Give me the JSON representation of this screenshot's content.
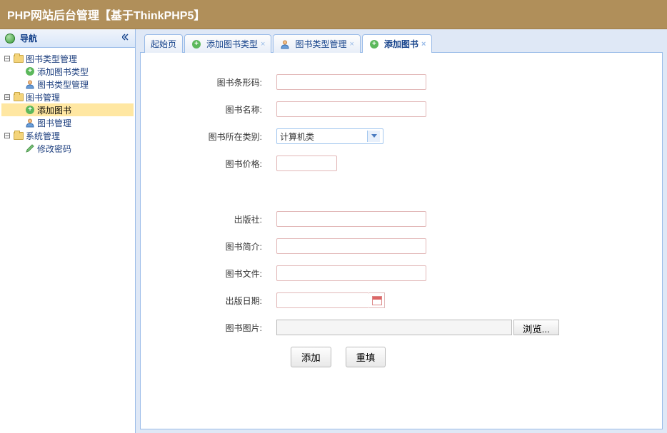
{
  "header": {
    "title": "PHP网站后台管理【基于ThinkPHP5】"
  },
  "sidebar": {
    "title": "导航",
    "tree": [
      {
        "label": "图书类型管理",
        "icon": "folder",
        "level": 0,
        "expanded": true,
        "hasChildren": true
      },
      {
        "label": "添加图书类型",
        "icon": "add",
        "level": 1,
        "leaf": true
      },
      {
        "label": "图书类型管理",
        "icon": "user",
        "level": 1,
        "leaf": true
      },
      {
        "label": "图书管理",
        "icon": "folder",
        "level": 0,
        "expanded": true,
        "hasChildren": true
      },
      {
        "label": "添加图书",
        "icon": "add",
        "level": 1,
        "leaf": true,
        "selected": true
      },
      {
        "label": "图书管理",
        "icon": "user",
        "level": 1,
        "leaf": true
      },
      {
        "label": "系统管理",
        "icon": "folder",
        "level": 0,
        "expanded": true,
        "hasChildren": true
      },
      {
        "label": "修改密码",
        "icon": "pencil",
        "level": 1,
        "leaf": true
      }
    ]
  },
  "tabs": [
    {
      "label": "起始页",
      "icon": "",
      "closable": false,
      "active": false
    },
    {
      "label": "添加图书类型",
      "icon": "add",
      "closable": true,
      "active": false
    },
    {
      "label": "图书类型管理",
      "icon": "user",
      "closable": true,
      "active": false
    },
    {
      "label": "添加图书",
      "icon": "add",
      "closable": true,
      "active": true
    }
  ],
  "form": {
    "fields": {
      "barcode": "图书条形码:",
      "name": "图书名称:",
      "category": "图书所在类别:",
      "price": "图书价格:",
      "publisher": "出版社:",
      "intro": "图书简介:",
      "file": "图书文件:",
      "pubdate": "出版日期:",
      "image": "图书图片:"
    },
    "category_value": "计算机类",
    "browse_label": "浏览...",
    "submit_label": "添加",
    "reset_label": "重填"
  }
}
